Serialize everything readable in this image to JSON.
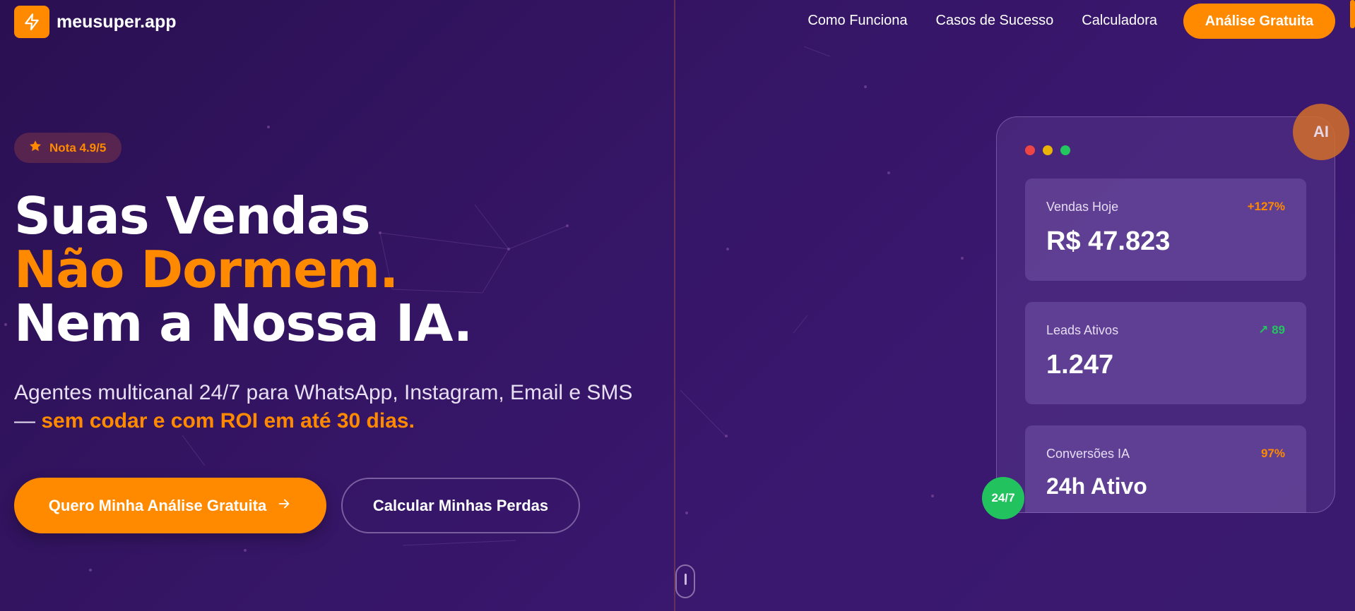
{
  "brand": {
    "name": "meusuper.app",
    "accent": "#ff8a00"
  },
  "nav": {
    "items": [
      "Como Funciona",
      "Casos de Sucesso",
      "Calculadora"
    ],
    "cta": "Análise Gratuita"
  },
  "hero": {
    "rating": "Nota 4.9/5",
    "headline": [
      "Suas Vendas",
      "Não Dormem.",
      "Nem a Nossa IA."
    ],
    "subtitle": "Agentes multicanal 24/7 para WhatsApp, Instagram, Email e SMS — ",
    "subtitle_highlight": "sem codar e com ROI em até 30 dias.",
    "primary_cta": "Quero Minha Análise Gratuita",
    "secondary_cta": "Calcular Minhas Perdas"
  },
  "dashboard": {
    "window_dots": [
      "#ef4444",
      "#eab308",
      "#22c55e"
    ],
    "stats": [
      {
        "label": "Vendas Hoje",
        "delta": "+127%",
        "delta_color": "#ff8a00",
        "value": "R$ 47.823"
      },
      {
        "label": "Leads Ativos",
        "delta": "↗ 89",
        "delta_color": "#22c55e",
        "value": "1.247"
      },
      {
        "label": "Conversões IA",
        "delta": "97%",
        "delta_color": "#ff8a00",
        "value": "24h Ativo"
      }
    ],
    "ai_badge": "AI",
    "uptime_badge": "24/7"
  }
}
